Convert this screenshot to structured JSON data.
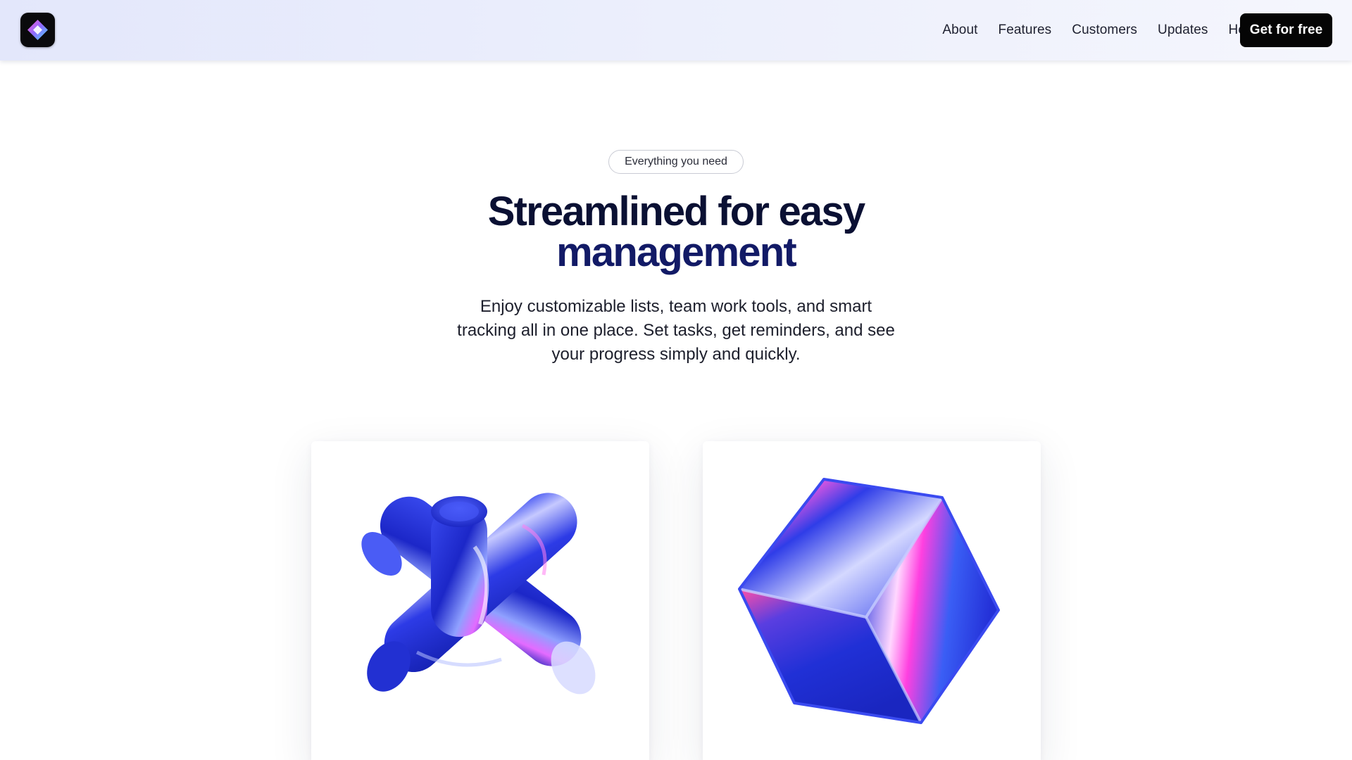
{
  "header": {
    "nav": [
      "About",
      "Features",
      "Customers",
      "Updates",
      "Help"
    ],
    "cta_label": "Get for free"
  },
  "hero": {
    "badge": "Everything you need",
    "title_line1": "Streamlined for easy",
    "title_line2": "management",
    "description": "Enjoy customizable lists, team work tools, and smart tracking all in one place. Set tasks, get reminders, and see your progress simply and quickly."
  },
  "colors": {
    "header_bg": "#e8ebfb",
    "title_dark": "#0a1033",
    "title_blue": "#121a66",
    "cta_bg": "#050505",
    "shape_blue": "#1f2fd6"
  },
  "cards": [
    {
      "icon": "cross-shape-icon"
    },
    {
      "icon": "cube-shape-icon"
    }
  ]
}
